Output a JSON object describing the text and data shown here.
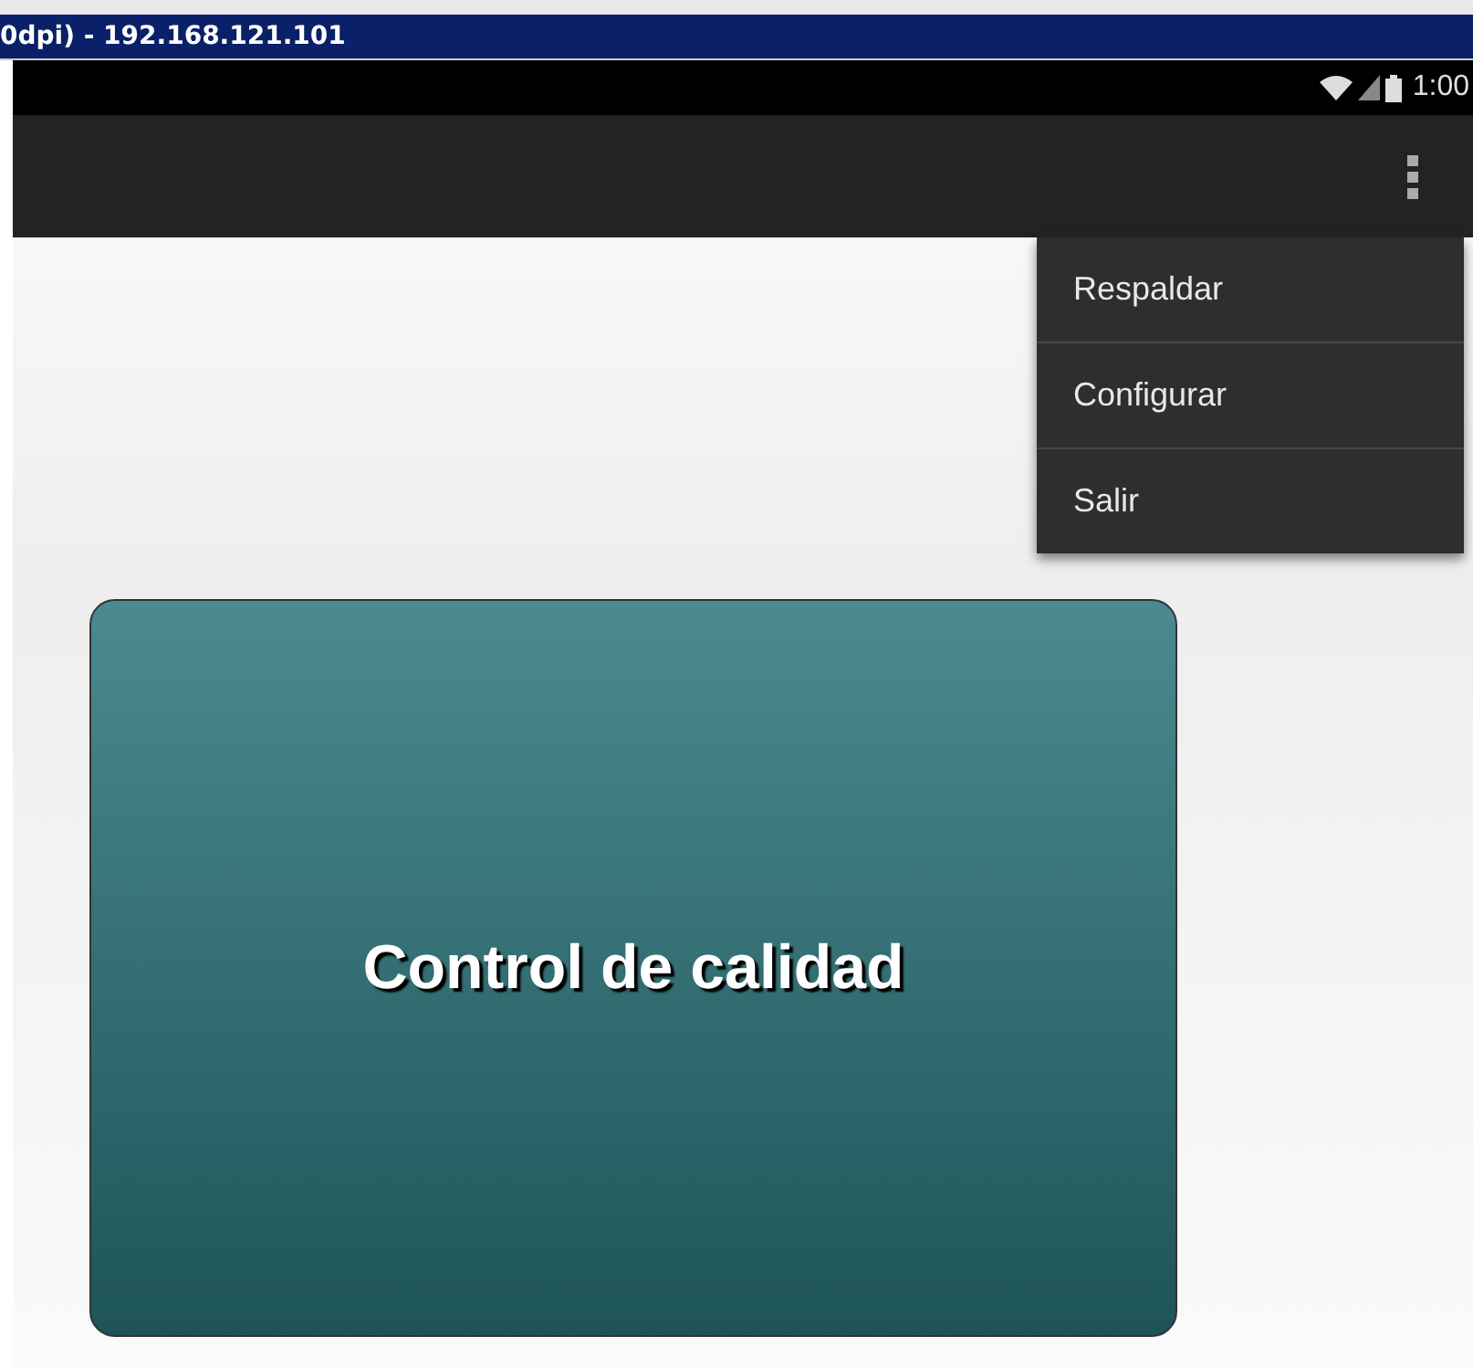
{
  "window": {
    "title": "0dpi) - 192.168.121.101"
  },
  "status_bar": {
    "time": "1:00"
  },
  "menu": {
    "items": [
      {
        "label": "Respaldar"
      },
      {
        "label": "Configurar"
      },
      {
        "label": "Salir"
      }
    ]
  },
  "card": {
    "label": "Control de calidad"
  }
}
